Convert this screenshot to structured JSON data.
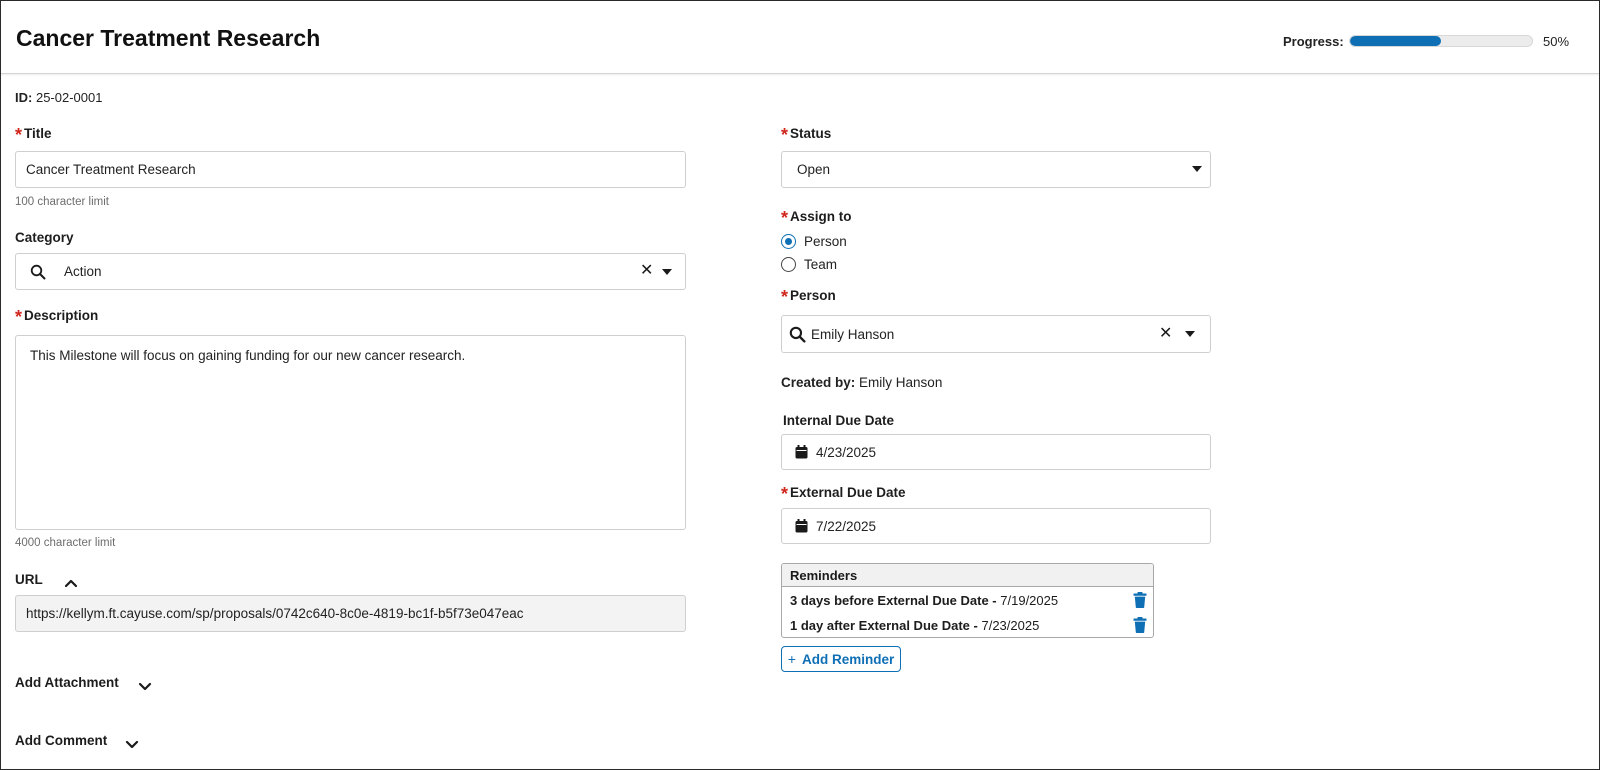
{
  "header": {
    "title": "Cancer Treatment Research",
    "progress_label": "Progress:",
    "progress_value": 50,
    "progress_text": "50%"
  },
  "record": {
    "id_label": "ID:",
    "id_value": "25-02-0001",
    "created_by_label": "Created by:",
    "created_by_value": "Emily Hanson"
  },
  "fields": {
    "title": {
      "label": "Title",
      "value": "Cancer Treatment Research",
      "hint": "100 character limit"
    },
    "category": {
      "label": "Category",
      "value": "Action"
    },
    "description": {
      "label": "Description",
      "value": "This Milestone will focus on gaining funding for our new cancer research.",
      "hint": "4000 character limit"
    },
    "url": {
      "label": "URL",
      "value": "https://kellym.ft.cayuse.com/sp/proposals/0742c640-8c0e-4819-bc1f-b5f73e047eac"
    },
    "status": {
      "label": "Status",
      "value": "Open"
    },
    "assign_to": {
      "label": "Assign to",
      "options": [
        "Person",
        "Team"
      ],
      "selected": "Person"
    },
    "person": {
      "label": "Person",
      "value": "Emily Hanson"
    },
    "internal_due": {
      "label": "Internal Due Date",
      "value": "4/23/2025"
    },
    "external_due": {
      "label": "External Due Date",
      "value": "7/22/2025"
    }
  },
  "sections": {
    "add_attachment": "Add Attachment",
    "add_comment": "Add Comment"
  },
  "reminders": {
    "header": "Reminders",
    "items": [
      {
        "rule": "3 days before External Due Date -",
        "date": "7/19/2025"
      },
      {
        "rule": "1 day after External Due Date -",
        "date": "7/23/2025"
      }
    ],
    "add_label": "Add Reminder"
  },
  "colors": {
    "accent": "#0e6fb5",
    "required": "#d0271d"
  }
}
